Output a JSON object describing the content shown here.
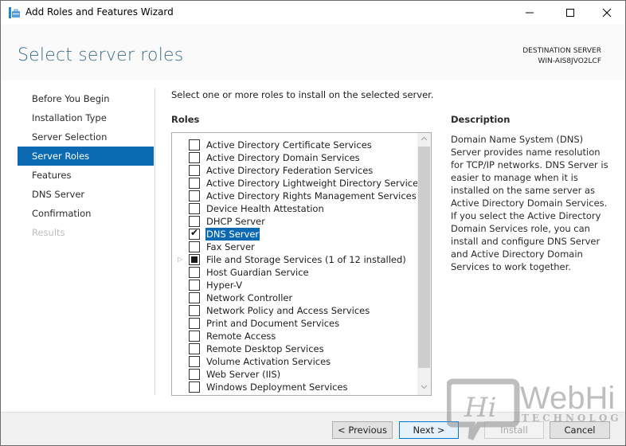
{
  "window": {
    "title": "Add Roles and Features Wizard",
    "controls": {
      "minimize": "minimize",
      "maximize": "maximize",
      "close": "close"
    }
  },
  "header": {
    "page_title": "Select server roles",
    "destination_label": "DESTINATION SERVER",
    "destination_server": "WIN-AIS8JVO2LCF"
  },
  "nav": {
    "items": [
      {
        "label": "Before You Begin",
        "state": "normal"
      },
      {
        "label": "Installation Type",
        "state": "normal"
      },
      {
        "label": "Server Selection",
        "state": "normal"
      },
      {
        "label": "Server Roles",
        "state": "active"
      },
      {
        "label": "Features",
        "state": "normal"
      },
      {
        "label": "DNS Server",
        "state": "normal"
      },
      {
        "label": "Confirmation",
        "state": "normal"
      },
      {
        "label": "Results",
        "state": "disabled"
      }
    ]
  },
  "main": {
    "instruction": "Select one or more roles to install on the selected server.",
    "roles_heading": "Roles",
    "roles": [
      {
        "label": "Active Directory Certificate Services",
        "state": "unchecked"
      },
      {
        "label": "Active Directory Domain Services",
        "state": "unchecked"
      },
      {
        "label": "Active Directory Federation Services",
        "state": "unchecked"
      },
      {
        "label": "Active Directory Lightweight Directory Services",
        "state": "unchecked"
      },
      {
        "label": "Active Directory Rights Management Services",
        "state": "unchecked"
      },
      {
        "label": "Device Health Attestation",
        "state": "unchecked"
      },
      {
        "label": "DHCP Server",
        "state": "unchecked"
      },
      {
        "label": "DNS Server",
        "state": "checked",
        "selected": true
      },
      {
        "label": "Fax Server",
        "state": "unchecked"
      },
      {
        "label": "File and Storage Services (1 of 12 installed)",
        "state": "partial",
        "expandable": true
      },
      {
        "label": "Host Guardian Service",
        "state": "unchecked"
      },
      {
        "label": "Hyper-V",
        "state": "unchecked"
      },
      {
        "label": "Network Controller",
        "state": "unchecked"
      },
      {
        "label": "Network Policy and Access Services",
        "state": "unchecked"
      },
      {
        "label": "Print and Document Services",
        "state": "unchecked"
      },
      {
        "label": "Remote Access",
        "state": "unchecked"
      },
      {
        "label": "Remote Desktop Services",
        "state": "unchecked"
      },
      {
        "label": "Volume Activation Services",
        "state": "unchecked"
      },
      {
        "label": "Web Server (IIS)",
        "state": "unchecked"
      },
      {
        "label": "Windows Deployment Services",
        "state": "unchecked"
      }
    ],
    "description_heading": "Description",
    "description": "Domain Name System (DNS) Server provides name resolution for TCP/IP networks. DNS Server is easier to manage when it is installed on the same server as Active Directory Domain Services. If you select the Active Directory Domain Services role, you can install and configure DNS Server and Active Directory Domain Services to work together."
  },
  "footer": {
    "previous_label": "< Previous",
    "next_label": "Next >",
    "install_label": "Install",
    "cancel_label": "Cancel"
  },
  "watermark": {
    "badge": "Hi",
    "brand": "WebHi",
    "tagline": "TECHNOLOGY"
  },
  "colors": {
    "accent": "#0b6ab1",
    "title": "#3c6e88"
  }
}
